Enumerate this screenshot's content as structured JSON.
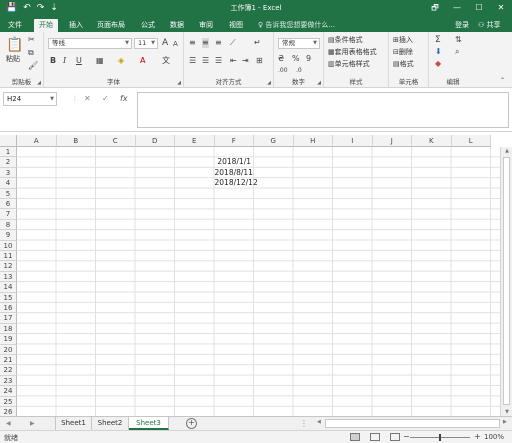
{
  "window": {
    "title": "工作簿1 - Excel",
    "quick_access": [
      "💾",
      "↶",
      "↷",
      "⇣"
    ],
    "controls": [
      "🗗",
      "—",
      "☐",
      "✕"
    ]
  },
  "ribbon_tabs": [
    "文件",
    "开始",
    "插入",
    "页面布局",
    "公式",
    "数据",
    "审阅",
    "视图"
  ],
  "active_tab": "开始",
  "tell_me": "♀ 告诉我您想要做什么...",
  "login": "登录",
  "share": "⚇ 共享",
  "clipboard": {
    "paste": "粘贴",
    "label": "剪贴板"
  },
  "font": {
    "name": "等线",
    "size": "11",
    "grow": "A",
    "shrink": "A",
    "bold": "B",
    "italic": "I",
    "underline": "U",
    "label": "字体"
  },
  "alignment": {
    "label": "对齐方式"
  },
  "number": {
    "format": "常规",
    "percent": "%",
    "comma": "9",
    "label": "数字"
  },
  "styles": {
    "items": [
      "条件格式",
      "套用表格格式",
      "单元格样式"
    ],
    "label": "样式"
  },
  "cells": {
    "items": [
      "插入",
      "删除",
      "格式"
    ],
    "label": "单元格"
  },
  "editing": {
    "label": "编辑"
  },
  "formula_bar": {
    "name_box": "H24",
    "cancel": "✕",
    "enter": "✓",
    "fx": "fx",
    "content": ""
  },
  "columns": [
    "A",
    "B",
    "C",
    "D",
    "E",
    "F",
    "G",
    "H",
    "I",
    "J",
    "K",
    "L"
  ],
  "rows": [
    "1",
    "2",
    "3",
    "4",
    "5",
    "6",
    "7",
    "8",
    "9",
    "10",
    "11",
    "12",
    "13",
    "14",
    "15",
    "16",
    "17",
    "18",
    "19",
    "20",
    "21",
    "22",
    "23",
    "24",
    "25",
    "26"
  ],
  "cell_data": [
    {
      "cell": "F2",
      "value": "2018/1/1"
    },
    {
      "cell": "F3",
      "value": "2018/8/11"
    },
    {
      "cell": "F4",
      "value": "2018/12/12"
    }
  ],
  "sheets": [
    "Sheet1",
    "Sheet2",
    "Sheet3"
  ],
  "active_sheet": "Sheet3",
  "add_sheet": "+",
  "status": {
    "ready": "就绪",
    "zoom": "100%",
    "zoom_minus": "−",
    "zoom_plus": "+"
  },
  "colors": {
    "brand": "#217346",
    "ribbon_bg": "#f3f3f3",
    "grid_line": "#e1e1e1"
  }
}
